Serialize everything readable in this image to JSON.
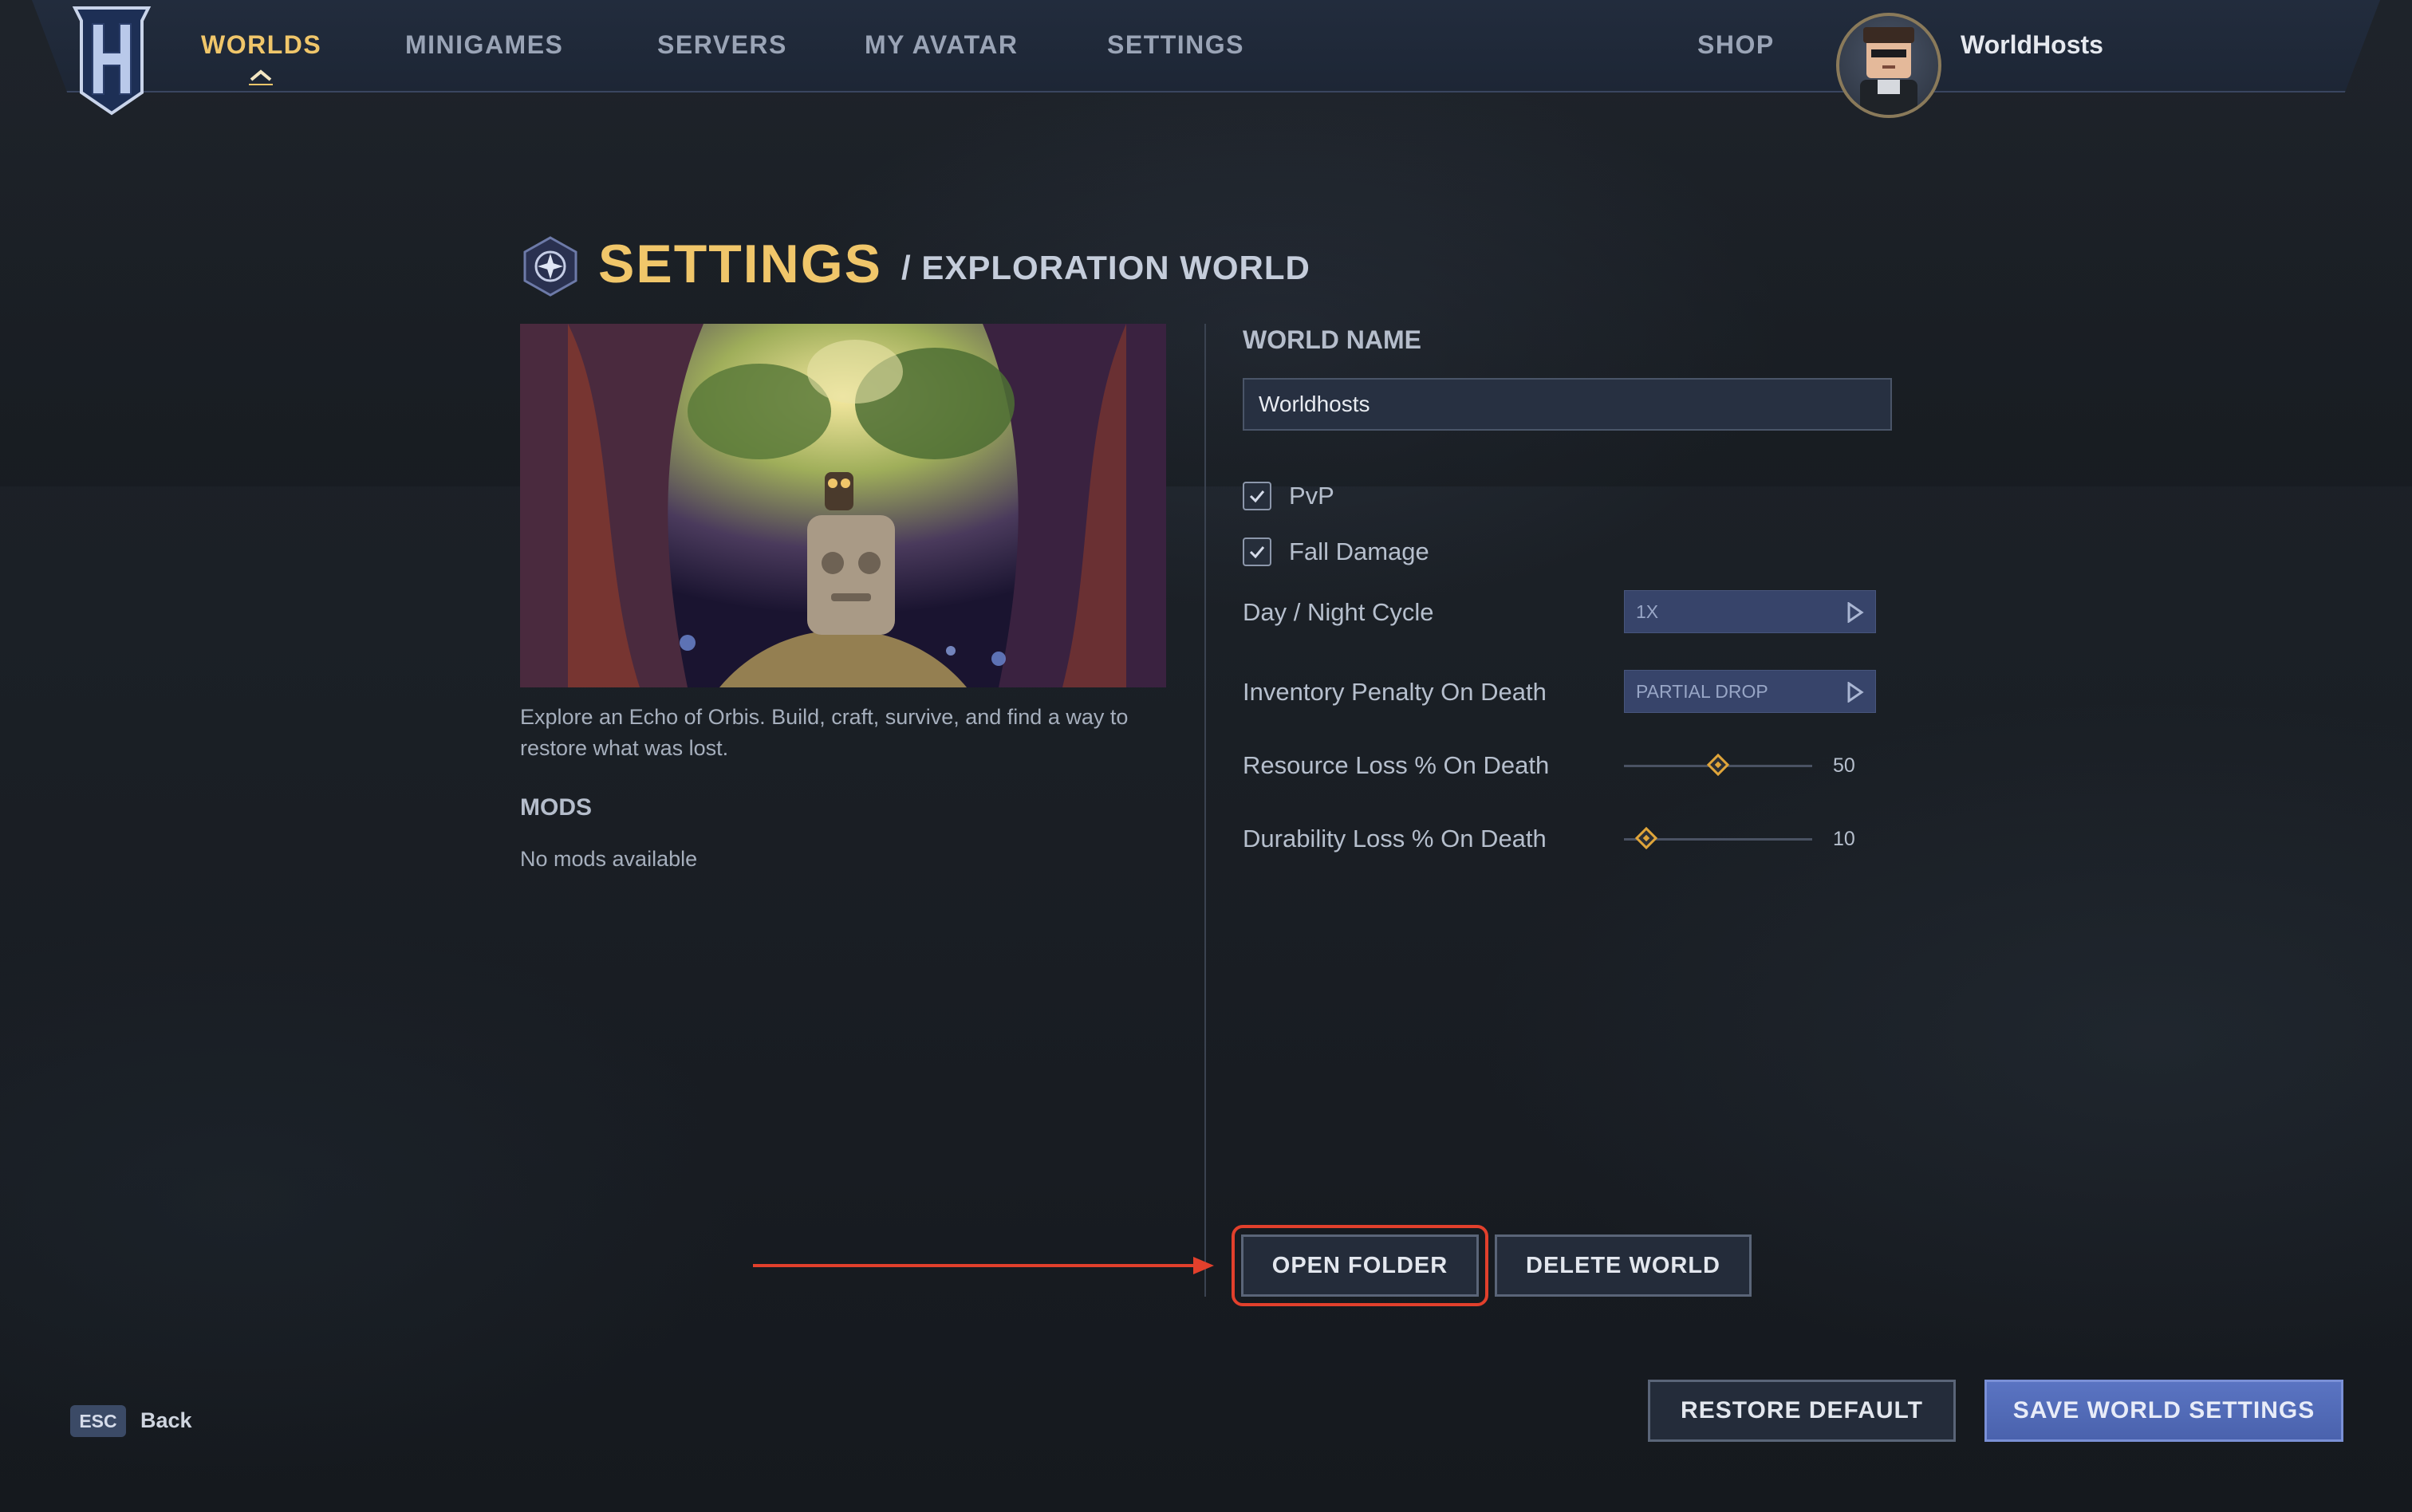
{
  "nav": {
    "items": [
      {
        "label": "WORLDS",
        "active": true
      },
      {
        "label": "MINIGAMES",
        "active": false
      },
      {
        "label": "SERVERS",
        "active": false
      },
      {
        "label": "MY AVATAR",
        "active": false
      },
      {
        "label": "SETTINGS",
        "active": false
      }
    ],
    "shop_label": "SHOP",
    "username": "WorldHosts"
  },
  "header": {
    "title": "SETTINGS",
    "subtitle": "/ EXPLORATION WORLD"
  },
  "world": {
    "description": "Explore an Echo of Orbis. Build, craft, survive, and find a way to restore what was lost.",
    "mods_heading": "MODS",
    "mods_value": "No mods available"
  },
  "form": {
    "world_name_label": "WORLD NAME",
    "world_name_value": "Worldhosts",
    "pvp_label": "PvP",
    "pvp_checked": true,
    "fall_damage_label": "Fall Damage",
    "fall_damage_checked": true,
    "day_night_label": "Day / Night Cycle",
    "day_night_value": "1X",
    "inventory_penalty_label": "Inventory Penalty On Death",
    "inventory_penalty_value": "PARTIAL DROP",
    "resource_loss_label": "Resource Loss % On Death",
    "resource_loss_value": "50",
    "durability_loss_label": "Durability Loss % On Death",
    "durability_loss_value": "10"
  },
  "actions": {
    "open_folder": "OPEN FOLDER",
    "delete_world": "DELETE WORLD",
    "restore_default": "RESTORE DEFAULT",
    "save_settings": "SAVE WORLD SETTINGS"
  },
  "footer": {
    "esc_key": "ESC",
    "back_label": "Back"
  },
  "colors": {
    "accent_gold": "#f0c66a",
    "primary_button": "#5a74c2",
    "annotation_red": "#e2402c"
  }
}
